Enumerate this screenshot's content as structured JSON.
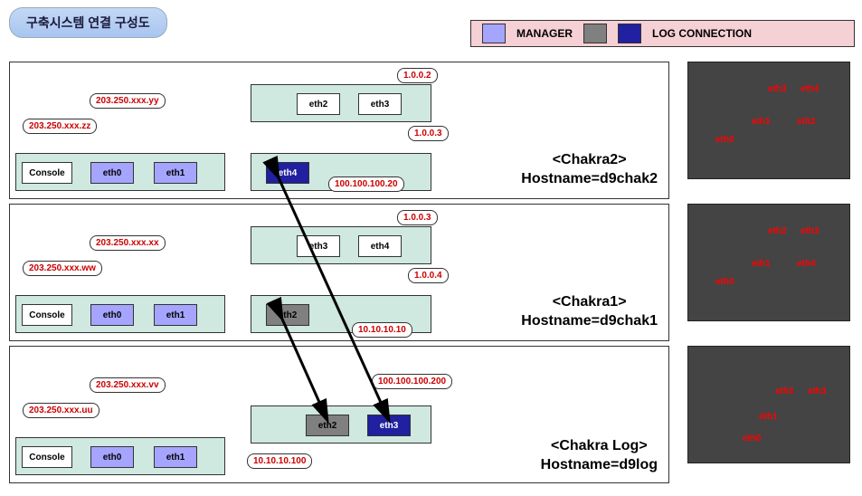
{
  "title": "구축시스템 연결 구성도",
  "legend": {
    "manager": "MANAGER",
    "log": "LOG CONNECTION"
  },
  "rows": [
    {
      "hostTitle": "<Chakra2>",
      "hostname": "Hostname=d9chak2",
      "left": {
        "ip1": "203.250.xxx.zz",
        "ip2": "203.250.xxx.yy",
        "ports": [
          "Console",
          "eth0",
          "eth1"
        ]
      },
      "rightA": {
        "ports": [
          "eth2",
          "eth3"
        ],
        "ipTop": "1.0.0.2",
        "ipBot": "1.0.0.3"
      },
      "rightB": {
        "ports": [
          "eth4"
        ],
        "ip": "100.100.100.20"
      }
    },
    {
      "hostTitle": "<Chakra1>",
      "hostname": "Hostname=d9chak1",
      "left": {
        "ip1": "203.250.xxx.ww",
        "ip2": "203.250.xxx.xx",
        "ports": [
          "Console",
          "eth0",
          "eth1"
        ]
      },
      "rightA": {
        "ports": [
          "eth3",
          "eth4"
        ],
        "ipTop": "1.0.0.3",
        "ipBot": "1.0.0.4"
      },
      "rightB": {
        "ports": [
          "eth2"
        ],
        "ip": "10.10.10.10"
      }
    },
    {
      "hostTitle": "<Chakra Log>",
      "hostname": "Hostname=d9log",
      "left": {
        "ip1": "203.250.xxx.uu",
        "ip2": "203.250.xxx.vv",
        "ports": [
          "Console",
          "eth0",
          "eth1"
        ]
      },
      "rightB": {
        "ports": [
          "eth2",
          "eth3"
        ],
        "ip1": "10.10.10.100",
        "ip2": "100.100.100.200"
      }
    }
  ],
  "photos": [
    {
      "labels": [
        "eth3",
        "eth4",
        "eth1",
        "eth2",
        "eth0"
      ]
    },
    {
      "labels": [
        "eth2",
        "eth3",
        "eth1",
        "eth4",
        "eth0"
      ]
    },
    {
      "labels": [
        "eth2",
        "eth3",
        "eth1",
        "eth0"
      ]
    }
  ]
}
